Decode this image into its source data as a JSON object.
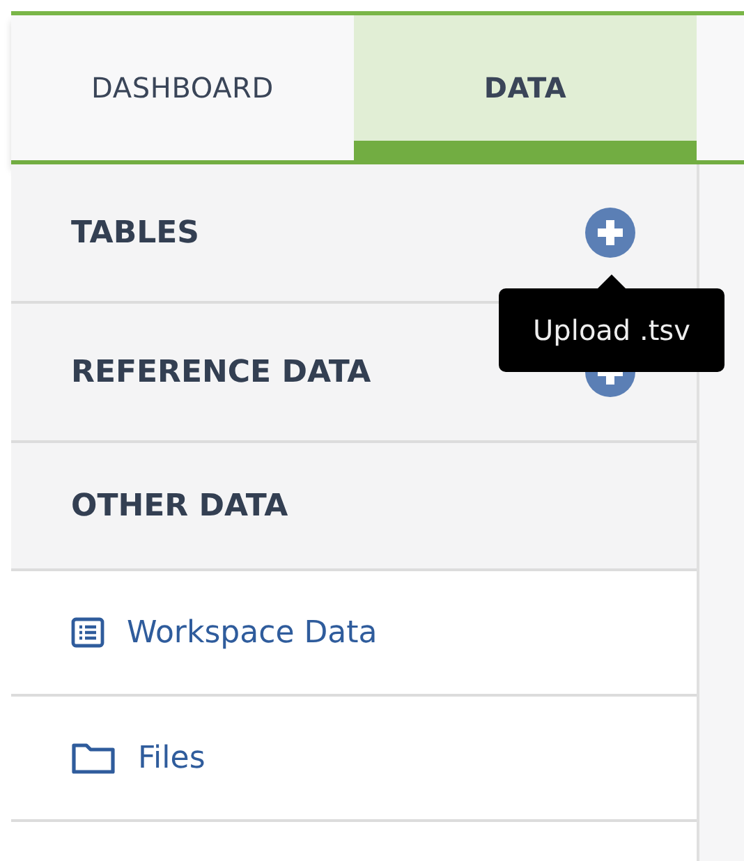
{
  "tabs": [
    {
      "label": "DASHBOARD",
      "selected": false
    },
    {
      "label": "DATA",
      "selected": true
    }
  ],
  "sidebar": {
    "items": [
      {
        "kind": "header",
        "label": "TABLES",
        "add_button": true
      },
      {
        "kind": "header",
        "label": "REFERENCE DATA",
        "add_button": true
      },
      {
        "kind": "header",
        "label": "OTHER DATA",
        "add_button": false
      },
      {
        "kind": "list",
        "label": "Workspace Data"
      },
      {
        "kind": "folder",
        "label": "Files"
      }
    ]
  },
  "tooltip": {
    "text": "Upload .tsv"
  }
}
